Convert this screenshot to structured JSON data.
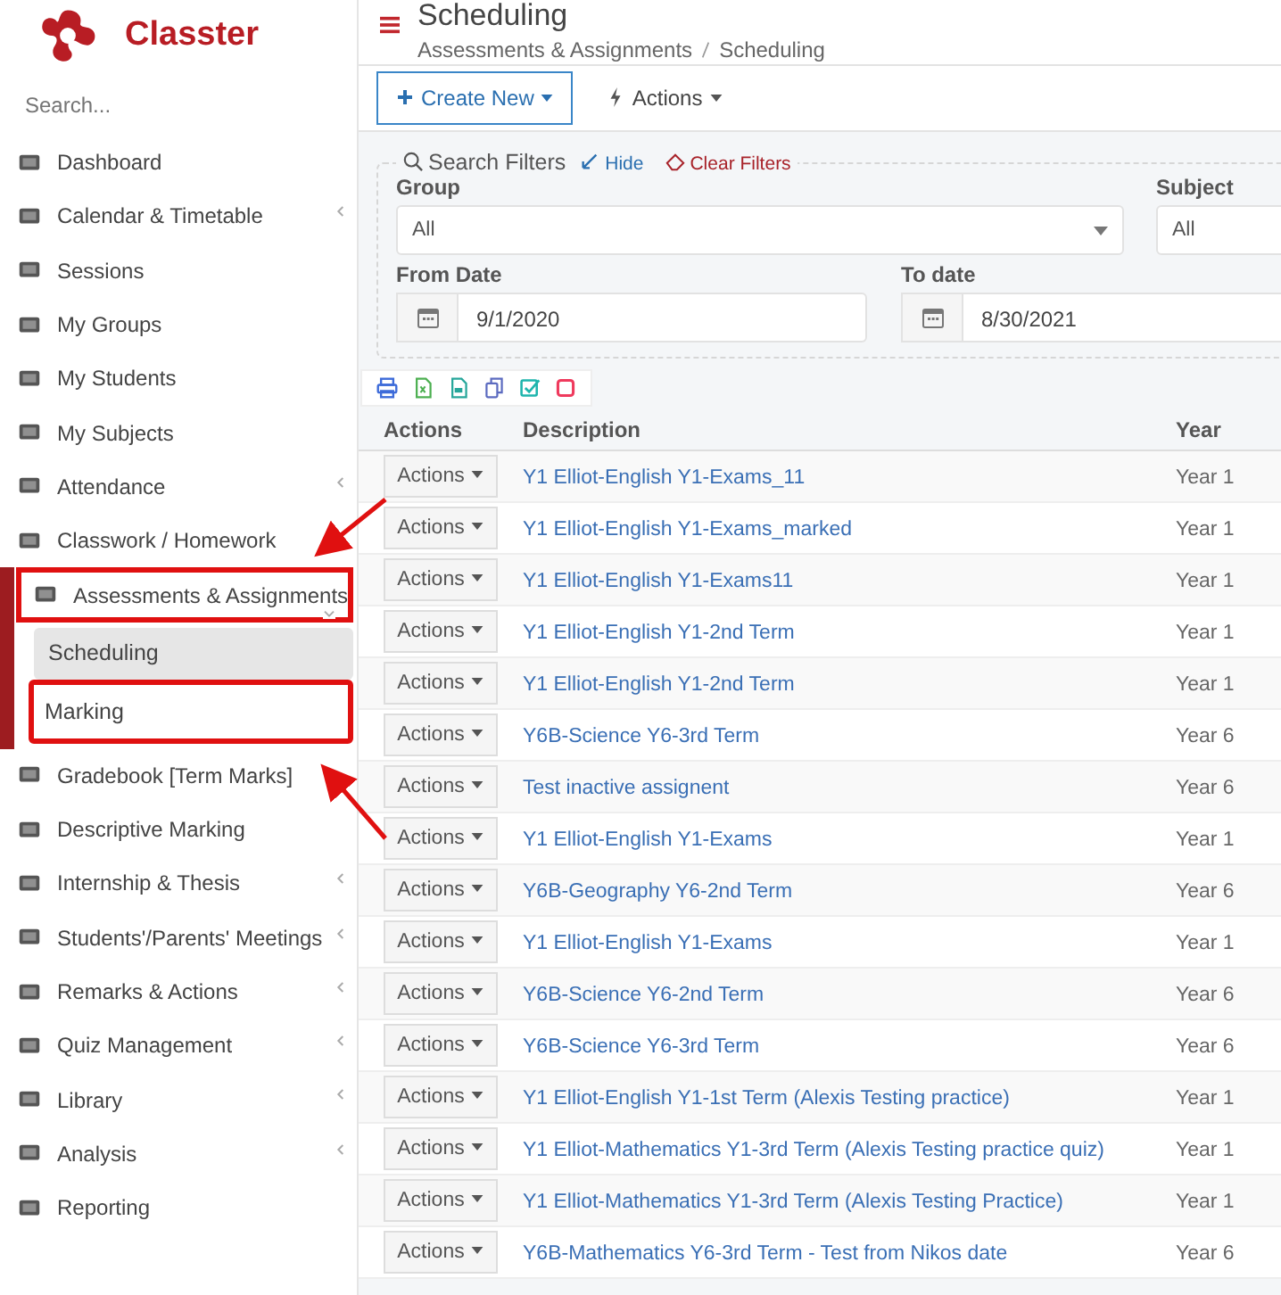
{
  "sidebar": {
    "logo_text": "Classter",
    "search_placeholder": "Search...",
    "items": [
      {
        "label": "Dashboard",
        "expandable": false,
        "expanded": false,
        "annotated": false
      },
      {
        "label": "Calendar & Timetable",
        "expandable": true,
        "expanded": false,
        "annotated": false
      },
      {
        "label": "Sessions",
        "expandable": false,
        "expanded": false,
        "annotated": false
      },
      {
        "label": "My Groups",
        "expandable": false,
        "expanded": false,
        "annotated": false
      },
      {
        "label": "My Students",
        "expandable": false,
        "expanded": false,
        "annotated": false
      },
      {
        "label": "My Subjects",
        "expandable": false,
        "expanded": false,
        "annotated": false
      },
      {
        "label": "Attendance",
        "expandable": true,
        "expanded": false,
        "annotated": false
      },
      {
        "label": "Classwork / Homework",
        "expandable": false,
        "expanded": false,
        "annotated": false
      },
      {
        "label": "Assessments & Assignments",
        "expandable": true,
        "expanded": true,
        "annotated": true,
        "children": [
          {
            "label": "Scheduling",
            "selected": true,
            "annotated": false
          },
          {
            "label": "Marking",
            "selected": false,
            "annotated": true
          }
        ]
      },
      {
        "label": "Gradebook [Term Marks]",
        "expandable": false,
        "expanded": false,
        "annotated": false
      },
      {
        "label": "Descriptive Marking",
        "expandable": false,
        "expanded": false,
        "annotated": false
      },
      {
        "label": "Internship & Thesis",
        "expandable": true,
        "expanded": false,
        "annotated": false
      },
      {
        "label": "Students'/Parents' Meetings",
        "expandable": true,
        "expanded": false,
        "annotated": false
      },
      {
        "label": "Remarks & Actions",
        "expandable": true,
        "expanded": false,
        "annotated": false
      },
      {
        "label": "Quiz Management",
        "expandable": true,
        "expanded": false,
        "annotated": false
      },
      {
        "label": "Library",
        "expandable": true,
        "expanded": false,
        "annotated": false
      },
      {
        "label": "Analysis",
        "expandable": true,
        "expanded": false,
        "annotated": false
      },
      {
        "label": "Reporting",
        "expandable": false,
        "expanded": false,
        "annotated": false
      }
    ]
  },
  "header": {
    "title": "Scheduling",
    "breadcrumb": [
      "Assessments & Assignments",
      "Scheduling"
    ]
  },
  "toolbar": {
    "create_button": "Create New",
    "actions_button": "Actions"
  },
  "filters": {
    "title": "Search Filters",
    "hide": "Hide",
    "clear": "Clear Filters",
    "fields": [
      {
        "label": "Group",
        "kind": "select",
        "value": "All"
      },
      {
        "label": "Subject",
        "kind": "select",
        "value": "All"
      },
      {
        "label": "From Date",
        "kind": "date",
        "value": "9/1/2020"
      },
      {
        "label": "To date",
        "kind": "date",
        "value": "8/30/2021"
      }
    ]
  },
  "table": {
    "columns": [
      "Actions",
      "Description",
      "Year"
    ],
    "rows": [
      {
        "action": "Actions",
        "description": "Y1 Elliot-English Y1-Exams_11",
        "year": "Year 1"
      },
      {
        "action": "Actions",
        "description": "Y1 Elliot-English Y1-Exams_marked",
        "year": "Year 1"
      },
      {
        "action": "Actions",
        "description": "Y1 Elliot-English Y1-Exams11",
        "year": "Year 1"
      },
      {
        "action": "Actions",
        "description": "Y1 Elliot-English Y1-2nd Term",
        "year": "Year 1"
      },
      {
        "action": "Actions",
        "description": "Y1 Elliot-English Y1-2nd Term",
        "year": "Year 1"
      },
      {
        "action": "Actions",
        "description": "Y6B-Science Y6-3rd Term",
        "year": "Year 6"
      },
      {
        "action": "Actions",
        "description": "Test inactive assignent",
        "year": "Year 6"
      },
      {
        "action": "Actions",
        "description": "Y1 Elliot-English Y1-Exams",
        "year": "Year 1"
      },
      {
        "action": "Actions",
        "description": "Y6B-Geography Y6-2nd Term",
        "year": "Year 6"
      },
      {
        "action": "Actions",
        "description": "Y1 Elliot-English Y1-Exams",
        "year": "Year 1"
      },
      {
        "action": "Actions",
        "description": "Y6B-Science Y6-2nd Term",
        "year": "Year 6"
      },
      {
        "action": "Actions",
        "description": "Y6B-Science Y6-3rd Term",
        "year": "Year 6"
      },
      {
        "action": "Actions",
        "description": "Y1 Elliot-English Y1-1st Term (Alexis Testing practice)",
        "year": "Year 1"
      },
      {
        "action": "Actions",
        "description": "Y1 Elliot-Mathematics Y1-3rd Term (Alexis Testing practice quiz)",
        "year": "Year 1"
      },
      {
        "action": "Actions",
        "description": "Y1 Elliot-Mathematics Y1-3rd Term (Alexis Testing Practice)",
        "year": "Year 1"
      },
      {
        "action": "Actions",
        "description": "Y6B-Mathematics Y6-3rd Term - Test from Nikos date",
        "year": "Year 6"
      }
    ]
  }
}
